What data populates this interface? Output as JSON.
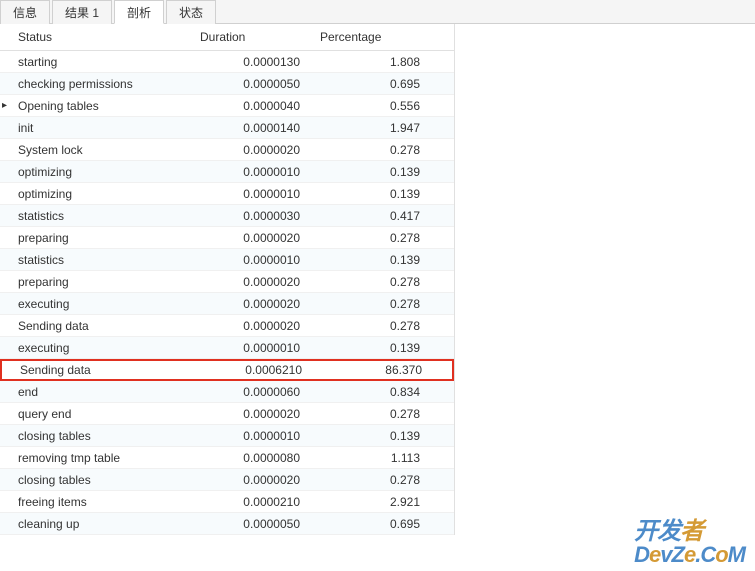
{
  "tabs": [
    {
      "label": "信息",
      "active": false
    },
    {
      "label": "结果 1",
      "active": false
    },
    {
      "label": "剖析",
      "active": true
    },
    {
      "label": "状态",
      "active": false
    }
  ],
  "headers": {
    "status": "Status",
    "duration": "Duration",
    "percentage": "Percentage"
  },
  "rows": [
    {
      "status": "starting",
      "duration": "0.0000130",
      "percentage": "1.808",
      "marker": "",
      "highlighted": false
    },
    {
      "status": "checking permissions",
      "duration": "0.0000050",
      "percentage": "0.695",
      "marker": "",
      "highlighted": false
    },
    {
      "status": "Opening tables",
      "duration": "0.0000040",
      "percentage": "0.556",
      "marker": "▸",
      "highlighted": false
    },
    {
      "status": "init",
      "duration": "0.0000140",
      "percentage": "1.947",
      "marker": "",
      "highlighted": false
    },
    {
      "status": "System lock",
      "duration": "0.0000020",
      "percentage": "0.278",
      "marker": "",
      "highlighted": false
    },
    {
      "status": "optimizing",
      "duration": "0.0000010",
      "percentage": "0.139",
      "marker": "",
      "highlighted": false
    },
    {
      "status": "optimizing",
      "duration": "0.0000010",
      "percentage": "0.139",
      "marker": "",
      "highlighted": false
    },
    {
      "status": "statistics",
      "duration": "0.0000030",
      "percentage": "0.417",
      "marker": "",
      "highlighted": false
    },
    {
      "status": "preparing",
      "duration": "0.0000020",
      "percentage": "0.278",
      "marker": "",
      "highlighted": false
    },
    {
      "status": "statistics",
      "duration": "0.0000010",
      "percentage": "0.139",
      "marker": "",
      "highlighted": false
    },
    {
      "status": "preparing",
      "duration": "0.0000020",
      "percentage": "0.278",
      "marker": "",
      "highlighted": false
    },
    {
      "status": "executing",
      "duration": "0.0000020",
      "percentage": "0.278",
      "marker": "",
      "highlighted": false
    },
    {
      "status": "Sending data",
      "duration": "0.0000020",
      "percentage": "0.278",
      "marker": "",
      "highlighted": false
    },
    {
      "status": "executing",
      "duration": "0.0000010",
      "percentage": "0.139",
      "marker": "",
      "highlighted": false
    },
    {
      "status": "Sending data",
      "duration": "0.0006210",
      "percentage": "86.370",
      "marker": "",
      "highlighted": true
    },
    {
      "status": "end",
      "duration": "0.0000060",
      "percentage": "0.834",
      "marker": "",
      "highlighted": false
    },
    {
      "status": "query end",
      "duration": "0.0000020",
      "percentage": "0.278",
      "marker": "",
      "highlighted": false
    },
    {
      "status": "closing tables",
      "duration": "0.0000010",
      "percentage": "0.139",
      "marker": "",
      "highlighted": false
    },
    {
      "status": "removing tmp table",
      "duration": "0.0000080",
      "percentage": "1.113",
      "marker": "",
      "highlighted": false
    },
    {
      "status": "closing tables",
      "duration": "0.0000020",
      "percentage": "0.278",
      "marker": "",
      "highlighted": false
    },
    {
      "status": "freeing items",
      "duration": "0.0000210",
      "percentage": "2.921",
      "marker": "",
      "highlighted": false
    },
    {
      "status": "cleaning up",
      "duration": "0.0000050",
      "percentage": "0.695",
      "marker": "",
      "highlighted": false
    }
  ],
  "watermark": {
    "line1_a": "开发",
    "line1_b": "者",
    "line2_a": "D",
    "line2_b": "e",
    "line2_c": "vZ",
    "line2_d": "e",
    "line2_e": ".C",
    "line2_f": "o",
    "line2_g": "M"
  }
}
